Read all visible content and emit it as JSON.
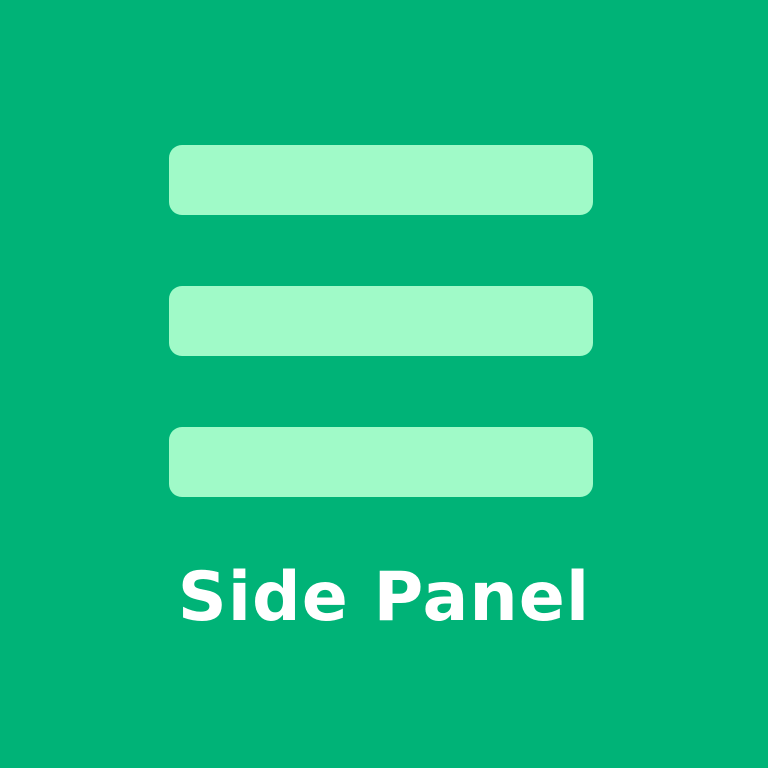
{
  "tile": {
    "background_color": "#00B377",
    "icon": "menu-hamburger-icon",
    "icon_color": "#A0FAC8",
    "label": "Side Panel",
    "label_color": "#FFFFFF"
  }
}
